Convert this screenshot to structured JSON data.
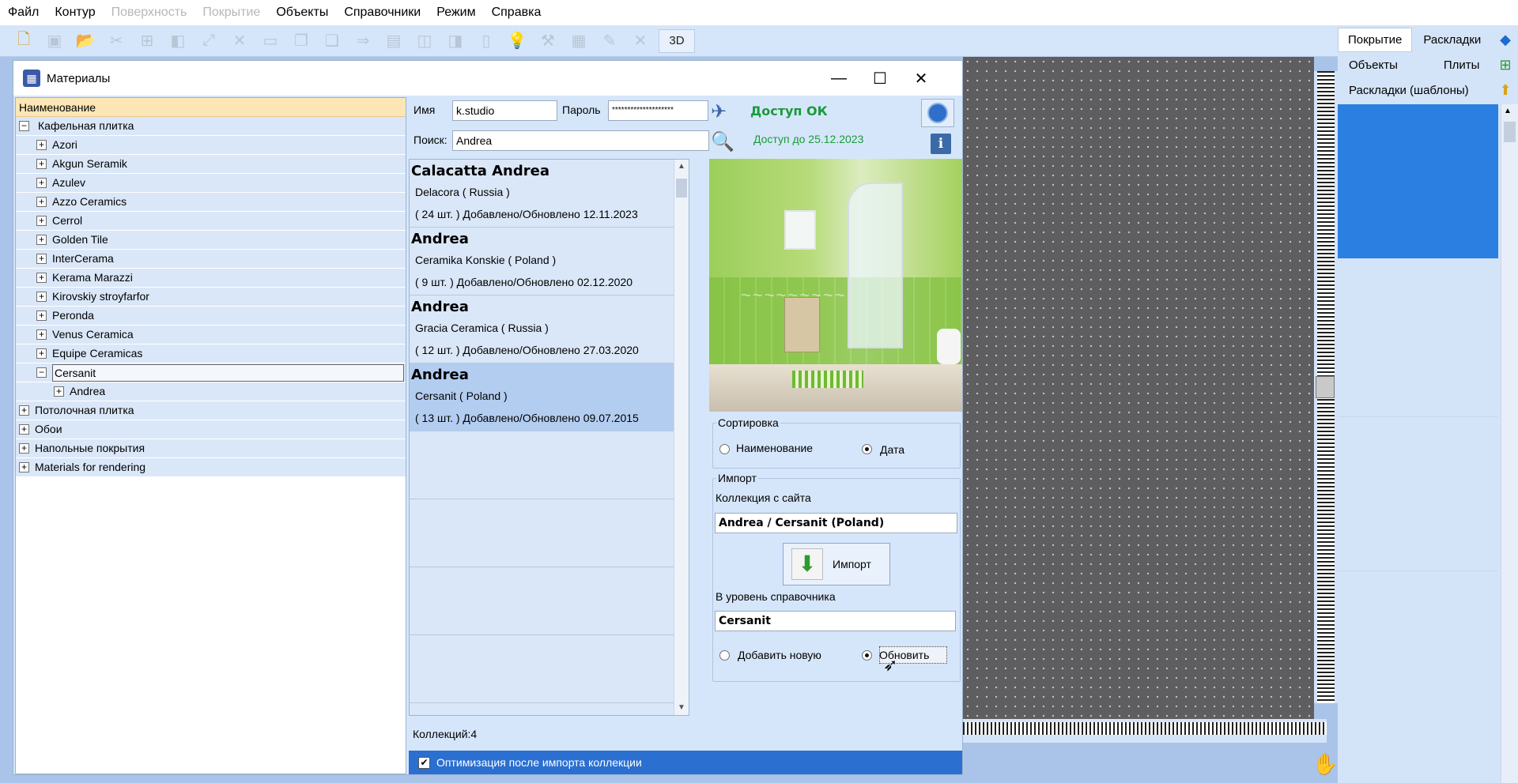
{
  "menu": [
    "Файл",
    "Контур",
    "Поверхность",
    "Покрытие",
    "Объекты",
    "Справочники",
    "Режим",
    "Справка"
  ],
  "menu_disabled": [
    false,
    false,
    true,
    true,
    false,
    false,
    false,
    false
  ],
  "toolbar": {
    "btn_3d": "3D"
  },
  "right_panel": {
    "tab_cover": "Покрытие",
    "tab_layouts": "Раскладки",
    "tab_objects": "Объекты",
    "tab_tiles": "Плиты",
    "tab_templates": "Раскладки (шаблоны)"
  },
  "dialog": {
    "title": "Материалы",
    "tree_header": "Наименование",
    "tree": [
      {
        "label": "Кафельная плитка",
        "glyph": "−"
      },
      {
        "label": "Azori",
        "glyph": "+"
      },
      {
        "label": "Akgun Seramik",
        "glyph": "+"
      },
      {
        "label": "Azulev",
        "glyph": "+"
      },
      {
        "label": "Azzo Ceramics",
        "glyph": "+"
      },
      {
        "label": "Cerrol",
        "glyph": "+"
      },
      {
        "label": "Golden Tile",
        "glyph": "+"
      },
      {
        "label": "InterCerama",
        "glyph": "+"
      },
      {
        "label": "Kerama Marazzi",
        "glyph": "+"
      },
      {
        "label": "Kirovskiy stroyfarfor",
        "glyph": "+"
      },
      {
        "label": "Peronda",
        "glyph": "+"
      },
      {
        "label": "Venus Ceramica",
        "glyph": "+"
      },
      {
        "label": "Equipe Ceramicas",
        "glyph": "+"
      },
      {
        "label": "Cersanit",
        "glyph": "−"
      },
      {
        "label": "Andrea",
        "glyph": "+"
      },
      {
        "label": "Потолочная плитка",
        "glyph": "+"
      },
      {
        "label": "Обои",
        "glyph": "+"
      },
      {
        "label": "Напольные покрытия",
        "glyph": "+"
      },
      {
        "label": "Materials for rendering",
        "glyph": "+"
      }
    ],
    "name_label": "Имя",
    "name_value": "k.studio",
    "password_label": "Пароль",
    "password_value": "********************",
    "search_label": "Поиск:",
    "search_value": "Andrea",
    "access_status": "Доступ ОК",
    "access_until": "Доступ до 25.12.2023",
    "collections": [
      {
        "title": "Calacatta Andrea",
        "maker": "Delacora ( Russia )",
        "info": "( 24 шт. ) Добавлено/Обновлено 12.11.2023"
      },
      {
        "title": "Andrea",
        "maker": "Ceramika Konskie ( Poland )",
        "info": "(  9 шт. ) Добавлено/Обновлено 02.12.2020"
      },
      {
        "title": "Andrea",
        "maker": "Gracia Ceramica ( Russia )",
        "info": "( 12 шт. ) Добавлено/Обновлено 27.03.2020"
      },
      {
        "title": "Andrea",
        "maker": "Cersanit ( Poland )",
        "info": "( 13 шт. ) Добавлено/Обновлено 09.07.2015"
      }
    ],
    "collections_count": "Коллекций:4",
    "optimize_label": "Оптимизация после импорта коллекции",
    "sort": {
      "group_label": "Сортировка",
      "by_name": "Наименование",
      "by_date": "Дата",
      "selected": "date"
    },
    "import": {
      "group_label": "Импорт",
      "site_collection_label": "Коллекция с сайта",
      "site_collection_value": "Andrea / Cersanit (Poland)",
      "button_label": "Импорт",
      "level_label": "В уровень справочника",
      "level_value": "Cersanit",
      "add_new": "Добавить новую",
      "update": "Обновить",
      "selected": "update"
    }
  },
  "colors": {
    "accent_blue": "#2b7fe0",
    "access_green": "#1a9a3a",
    "tree_header": "#fde6b6"
  }
}
